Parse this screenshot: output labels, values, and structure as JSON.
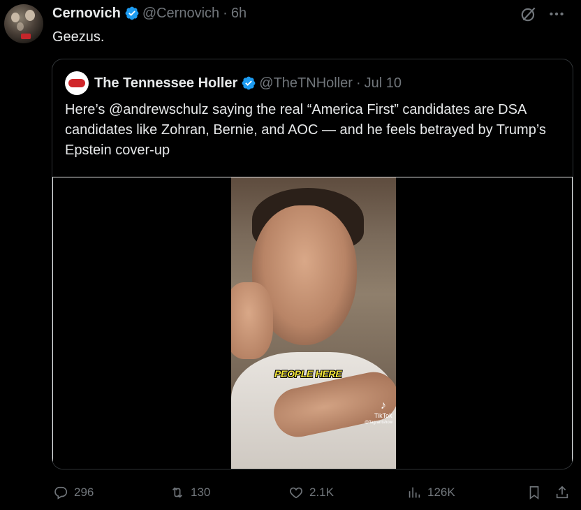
{
  "tweet": {
    "author_name": "Cernovich",
    "handle": "@Cernovich",
    "separator": "·",
    "time": "6h",
    "text": "Geezus."
  },
  "quote": {
    "author_name": "The Tennessee Holler",
    "handle": "@TheTNHoller",
    "separator": "·",
    "date": "Jul 10",
    "text": "Here’s @andrewschulz saying the real “America First” candidates are DSA candidates like Zohran, Bernie, and AOC — and he feels betrayed by Trump’s Epstein cover-up",
    "video": {
      "caption": "PEOPLE HERE",
      "watermark": "TikTok",
      "watermark_handle": "@flagrantshow"
    }
  },
  "actions": {
    "replies": "296",
    "reposts": "130",
    "likes": "2.1K",
    "views": "126K"
  },
  "colors": {
    "background": "#000000",
    "text": "#e7e9ea",
    "muted": "#71767b",
    "verified": "#1d9bf0",
    "border": "#2f3336",
    "caption": "#f2e53a"
  },
  "icons": {
    "verified": "verified-badge-icon",
    "grok": "grok-icon",
    "more": "more-icon",
    "reply": "reply-icon",
    "repost": "repost-icon",
    "like": "like-icon",
    "views": "views-icon",
    "bookmark": "bookmark-icon",
    "share": "share-icon"
  }
}
